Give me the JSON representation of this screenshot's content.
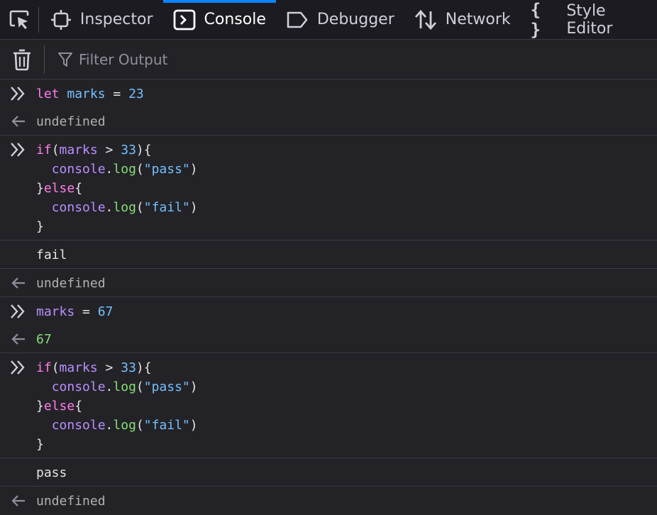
{
  "tabs": [
    {
      "label": "Inspector",
      "icon": "inspector-icon"
    },
    {
      "label": "Console",
      "icon": "console-icon"
    },
    {
      "label": "Debugger",
      "icon": "debugger-icon"
    },
    {
      "label": "Network",
      "icon": "network-icon"
    },
    {
      "label": "Style Editor",
      "icon": "style-editor-icon"
    }
  ],
  "toolbar": {
    "filter_placeholder": "Filter Output"
  },
  "entries": {
    "e1": {
      "let": "let",
      "name": "marks",
      "eq": " = ",
      "value": "23"
    },
    "r1": "undefined",
    "e2": {
      "l1_if": "if",
      "l1_open": "(",
      "l1_var": "marks",
      "l1_op": " > ",
      "l1_num": "33",
      "l1_close": "){",
      "l2_console": "console",
      "l2_dot": ".",
      "l2_log": "log",
      "l2_open": "(",
      "l2_str": "\"pass\"",
      "l2_close": ")",
      "l3_brace": "}",
      "l3_else": "else",
      "l3_open": "{",
      "l4_console": "console",
      "l4_dot": ".",
      "l4_log": "log",
      "l4_open": "(",
      "l4_str": "\"fail\"",
      "l4_close": ")",
      "l5_brace": "}"
    },
    "o2": "fail",
    "r2": "undefined",
    "e3": {
      "name": "marks",
      "eq": " = ",
      "value": "67"
    },
    "r3": "67",
    "e4": {
      "l1_if": "if",
      "l1_open": "(",
      "l1_var": "marks",
      "l1_op": " > ",
      "l1_num": "33",
      "l1_close": "){",
      "l2_console": "console",
      "l2_dot": ".",
      "l2_log": "log",
      "l2_open": "(",
      "l2_str": "\"pass\"",
      "l2_close": ")",
      "l3_brace": "}",
      "l3_else": "else",
      "l3_open": "{",
      "l4_console": "console",
      "l4_dot": ".",
      "l4_log": "log",
      "l4_open": "(",
      "l4_str": "\"fail\"",
      "l4_close": ")",
      "l5_brace": "}"
    },
    "o4": "pass",
    "r4": "undefined"
  }
}
